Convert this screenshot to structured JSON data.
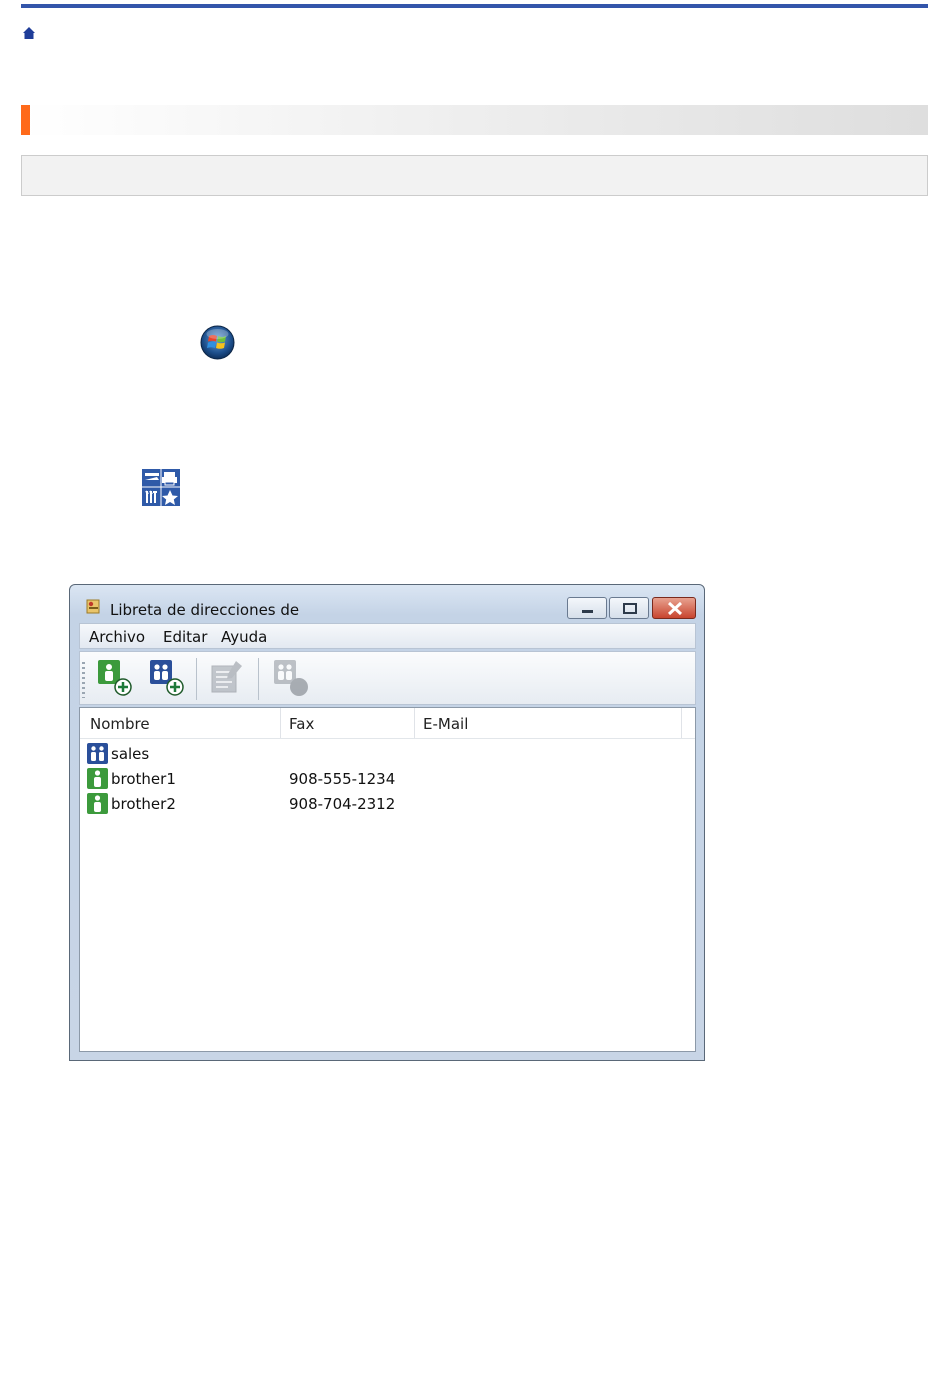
{
  "page": {
    "home_icon": "home-icon",
    "start_icon": "windows-start-orb-icon",
    "utility_icon": "brother-utilities-icon"
  },
  "window": {
    "title": "Libreta de direcciones de",
    "icon": "address-book-icon",
    "menu": [
      "Archivo",
      "Editar",
      "Ayuda"
    ],
    "toolbar": [
      {
        "name": "add-contact-button",
        "icon": "add-contact-icon",
        "enabled": true
      },
      {
        "name": "add-group-button",
        "icon": "add-group-icon",
        "enabled": true
      },
      {
        "name": "edit-button",
        "icon": "edit-icon",
        "enabled": false
      },
      {
        "name": "delete-button",
        "icon": "delete-icon",
        "enabled": false
      }
    ],
    "columns": [
      "Nombre",
      "Fax",
      "E-Mail"
    ],
    "rows": [
      {
        "type": "group",
        "name": "sales",
        "fax": "",
        "email": ""
      },
      {
        "type": "contact",
        "name": "brother1",
        "fax": "908-555-1234",
        "email": ""
      },
      {
        "type": "contact",
        "name": "brother2",
        "fax": "908-704-2312",
        "email": ""
      }
    ]
  },
  "colors": {
    "top_line": "#3355aa",
    "section_accent": "#ff6a1a",
    "contact_icon_green": "#3c9a3c",
    "group_icon_blue": "#2a4f9a"
  }
}
